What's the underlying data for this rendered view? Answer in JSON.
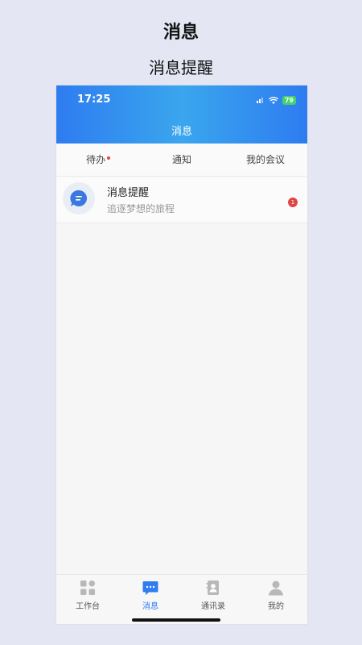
{
  "page": {
    "heading": "消息",
    "subheading": "消息提醒"
  },
  "status_bar": {
    "time": "17:25",
    "battery": "79"
  },
  "header": {
    "title": "消息"
  },
  "tabs": [
    {
      "label": "待办",
      "has_dot": true
    },
    {
      "label": "通知",
      "has_dot": false
    },
    {
      "label": "我的会议",
      "has_dot": false
    }
  ],
  "messages": [
    {
      "title": "消息提醒",
      "subtitle": "追逐梦想的旅程",
      "badge": "1",
      "icon": "chat-bubble-icon"
    }
  ],
  "bottom_nav": [
    {
      "label": "工作台",
      "icon": "grid-icon",
      "active": false
    },
    {
      "label": "消息",
      "icon": "message-icon",
      "active": true
    },
    {
      "label": "通讯录",
      "icon": "contacts-icon",
      "active": false
    },
    {
      "label": "我的",
      "icon": "profile-icon",
      "active": false
    }
  ],
  "colors": {
    "accent": "#2f7df0",
    "badge": "#e04545",
    "battery": "#45d26a"
  }
}
